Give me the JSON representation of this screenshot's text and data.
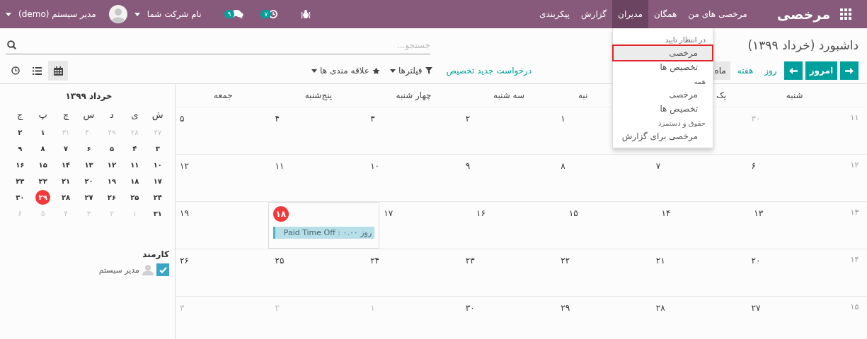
{
  "navbar": {
    "brand": "مرخصی",
    "menu": [
      {
        "label": "مرخصی های من",
        "selected": false
      },
      {
        "label": "همگان",
        "selected": false
      },
      {
        "label": "مدیران",
        "selected": true
      },
      {
        "label": "گزارش",
        "selected": false
      },
      {
        "label": "پیکربندی",
        "selected": false
      }
    ],
    "activity_badge": "۷",
    "messages_badge": "۹",
    "company": "نام شرکت شما",
    "user": "مدیر سیستم (demo)"
  },
  "dropdown": {
    "sections": [
      {
        "header": "در انتظار تایید",
        "items": [
          {
            "label": "مرخصی",
            "selected": true
          },
          {
            "label": "تخصیص ها",
            "selected": false
          }
        ]
      },
      {
        "header": "همه",
        "items": [
          {
            "label": "مرخصی",
            "selected": false
          },
          {
            "label": "تخصیص ها",
            "selected": false
          }
        ]
      },
      {
        "header": "حقوق و دستمزد",
        "items": [
          {
            "label": "مرخصی برای گزارش",
            "selected": false
          }
        ]
      }
    ]
  },
  "control_panel": {
    "breadcrumb": "داشبورد (خرداد ۱۳۹۹)",
    "search": {
      "placeholder": "جستجو..."
    },
    "today": "امروز",
    "scales": [
      {
        "label": "روز",
        "selected": false
      },
      {
        "label": "هفته",
        "selected": false
      },
      {
        "label": "ماه",
        "selected": true
      }
    ],
    "new_allocation": "درخواست جدید تخصیص",
    "filters": "فیلترها",
    "favorites": "علاقه مندی ها",
    "views": [
      {
        "kind": "calendar",
        "selected": true
      },
      {
        "kind": "list",
        "selected": false
      },
      {
        "kind": "activity",
        "selected": false
      }
    ]
  },
  "mini_calendar": {
    "title": "خرداد ۱۳۹۹",
    "weekdays": [
      "ش",
      "ی",
      "د",
      "س",
      "چ",
      "پ",
      "ج"
    ],
    "weeks": [
      [
        {
          "d": "۲۷",
          "muted": true,
          "today": false
        },
        {
          "d": "۲۸",
          "muted": true,
          "today": false
        },
        {
          "d": "۲۹",
          "muted": true,
          "today": false
        },
        {
          "d": "۳۰",
          "muted": true,
          "today": false
        },
        {
          "d": "۳۱",
          "muted": true,
          "today": false
        },
        {
          "d": "۱",
          "muted": false,
          "today": false
        },
        {
          "d": "۲",
          "muted": false,
          "today": false
        }
      ],
      [
        {
          "d": "۳",
          "muted": false,
          "today": false
        },
        {
          "d": "۴",
          "muted": false,
          "today": false
        },
        {
          "d": "۵",
          "muted": false,
          "today": false
        },
        {
          "d": "۶",
          "muted": false,
          "today": false
        },
        {
          "d": "۷",
          "muted": false,
          "today": false
        },
        {
          "d": "۸",
          "muted": false,
          "today": false
        },
        {
          "d": "۹",
          "muted": false,
          "today": false
        }
      ],
      [
        {
          "d": "۱۰",
          "muted": false,
          "today": false
        },
        {
          "d": "۱۱",
          "muted": false,
          "today": false
        },
        {
          "d": "۱۲",
          "muted": false,
          "today": false
        },
        {
          "d": "۱۳",
          "muted": false,
          "today": false
        },
        {
          "d": "۱۴",
          "muted": false,
          "today": false
        },
        {
          "d": "۱۵",
          "muted": false,
          "today": false
        },
        {
          "d": "۱۶",
          "muted": false,
          "today": false
        }
      ],
      [
        {
          "d": "۱۷",
          "muted": false,
          "today": false
        },
        {
          "d": "۱۸",
          "muted": false,
          "today": false
        },
        {
          "d": "۱۹",
          "muted": false,
          "today": false
        },
        {
          "d": "۲۰",
          "muted": false,
          "today": false
        },
        {
          "d": "۲۱",
          "muted": false,
          "today": false
        },
        {
          "d": "۲۲",
          "muted": false,
          "today": false
        },
        {
          "d": "۲۳",
          "muted": false,
          "today": false
        }
      ],
      [
        {
          "d": "۲۴",
          "muted": false,
          "today": false
        },
        {
          "d": "۲۵",
          "muted": false,
          "today": false
        },
        {
          "d": "۲۶",
          "muted": false,
          "today": false
        },
        {
          "d": "۲۷",
          "muted": false,
          "today": false
        },
        {
          "d": "۲۸",
          "muted": false,
          "today": false
        },
        {
          "d": "۲۹",
          "muted": false,
          "today": true
        },
        {
          "d": "۳۰",
          "muted": false,
          "today": false
        }
      ],
      [
        {
          "d": "۳۱",
          "muted": false,
          "today": false
        },
        {
          "d": "۱",
          "muted": true,
          "today": false
        },
        {
          "d": "۲",
          "muted": true,
          "today": false
        },
        {
          "d": "۳",
          "muted": true,
          "today": false
        },
        {
          "d": "۴",
          "muted": true,
          "today": false
        },
        {
          "d": "۵",
          "muted": true,
          "today": false
        },
        {
          "d": "۶",
          "muted": true,
          "today": false
        }
      ]
    ]
  },
  "employee_filter": {
    "title": "کارمند",
    "items": [
      {
        "label": "مدیر سیستم",
        "checked": true
      }
    ]
  },
  "calendar": {
    "headers": [
      "شنبه",
      "یک",
      "نبه",
      "سه شنبه",
      "چهار شنبه",
      "پنج‌شنبه",
      "جمعه"
    ],
    "weeks": [
      {
        "number": "۱۱",
        "second_day_covered": true,
        "days": [
          {
            "d": "۳۰",
            "muted": true,
            "today": false
          },
          {
            "d": "۱",
            "muted": false,
            "today": false
          },
          {
            "d": "۲",
            "muted": false,
            "today": false
          },
          {
            "d": "۳",
            "muted": false,
            "today": false
          },
          {
            "d": "۴",
            "muted": false,
            "today": false
          },
          {
            "d": "۵",
            "muted": false,
            "today": false
          }
        ]
      },
      {
        "number": "۱۲",
        "days": [
          {
            "d": "۶",
            "muted": false,
            "today": false
          },
          {
            "d": "۷",
            "muted": false,
            "today": false
          },
          {
            "d": "۸",
            "muted": false,
            "today": false
          },
          {
            "d": "۹",
            "muted": false,
            "today": false
          },
          {
            "d": "۱۰",
            "muted": false,
            "today": false
          },
          {
            "d": "۱۱",
            "muted": false,
            "today": false
          },
          {
            "d": "۱۲",
            "muted": false,
            "today": false
          }
        ]
      },
      {
        "number": "۱۳",
        "days": [
          {
            "d": "۱۳",
            "muted": false,
            "today": false
          },
          {
            "d": "۱۴",
            "muted": false,
            "today": false
          },
          {
            "d": "۱۵",
            "muted": false,
            "today": false
          },
          {
            "d": "۱۶",
            "muted": false,
            "today": false
          },
          {
            "d": "۱۷",
            "muted": false,
            "today": false
          },
          {
            "d": "۱۸",
            "muted": false,
            "today": true,
            "events": [
              "Paid Time Off : ۰.۰۰ روز"
            ]
          },
          {
            "d": "۱۹",
            "muted": false,
            "today": false
          }
        ]
      },
      {
        "number": "۱۴",
        "days": [
          {
            "d": "۲۰",
            "muted": false,
            "today": false
          },
          {
            "d": "۲۱",
            "muted": false,
            "today": false
          },
          {
            "d": "۲۲",
            "muted": false,
            "today": false
          },
          {
            "d": "۲۳",
            "muted": false,
            "today": false
          },
          {
            "d": "۲۴",
            "muted": false,
            "today": false
          },
          {
            "d": "۲۵",
            "muted": false,
            "today": false
          },
          {
            "d": "۲۶",
            "muted": false,
            "today": false
          }
        ]
      },
      {
        "number": "۱۵",
        "days": [
          {
            "d": "۲۷",
            "muted": false,
            "today": false
          },
          {
            "d": "۲۸",
            "muted": false,
            "today": false
          },
          {
            "d": "۲۹",
            "muted": false,
            "today": false
          },
          {
            "d": "۳۰",
            "muted": false,
            "today": false
          },
          {
            "d": "۱",
            "muted": true,
            "today": false
          },
          {
            "d": "۲",
            "muted": true,
            "today": false
          },
          {
            "d": "۳",
            "muted": true,
            "today": false
          }
        ]
      }
    ]
  }
}
